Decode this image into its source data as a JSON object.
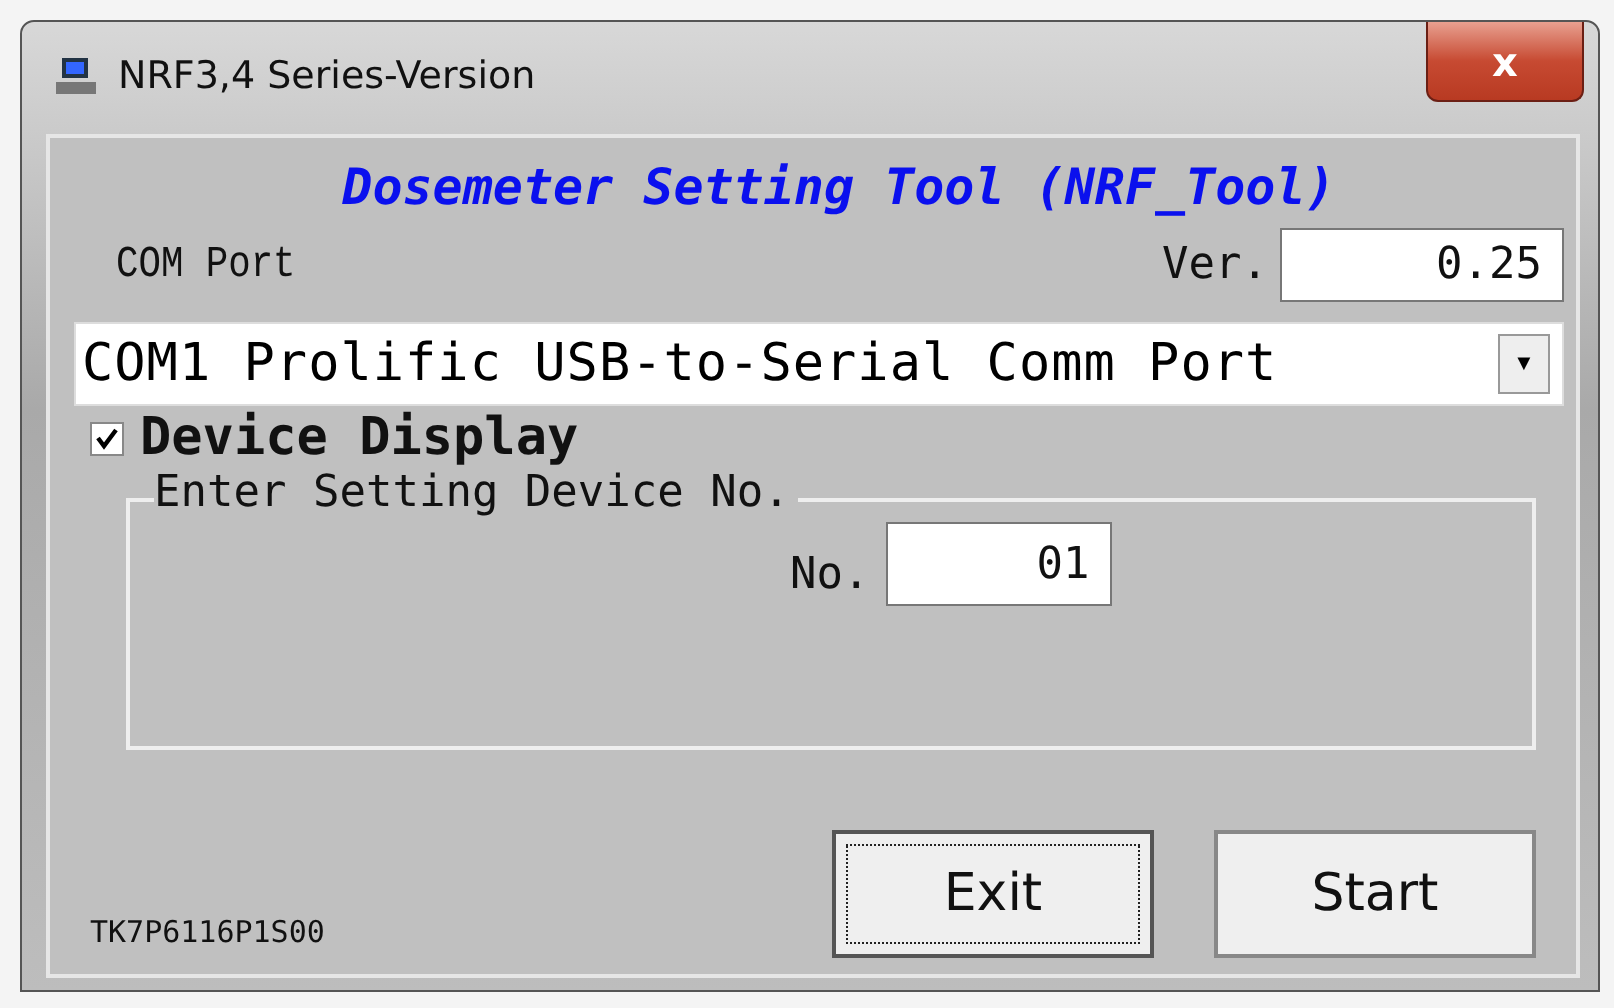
{
  "window": {
    "title": "NRF3,4 Series-Version",
    "close": "x"
  },
  "heading": "Dosemeter Setting Tool (NRF_Tool)",
  "com_port": {
    "label": "COM Port",
    "value": "COM1 Prolific USB-to-Serial Comm Port",
    "arrow": "▼"
  },
  "version": {
    "label": "Ver.",
    "value": "0.25"
  },
  "device_display": {
    "label": "Device Display",
    "checked": true
  },
  "group": {
    "title": "Enter Setting Device No.",
    "label": "No.",
    "value": "01"
  },
  "code": "TK7P6116P1S00",
  "buttons": [
    {
      "label": "Exit",
      "focused": true
    },
    {
      "label": "Start",
      "focused": false
    }
  ]
}
